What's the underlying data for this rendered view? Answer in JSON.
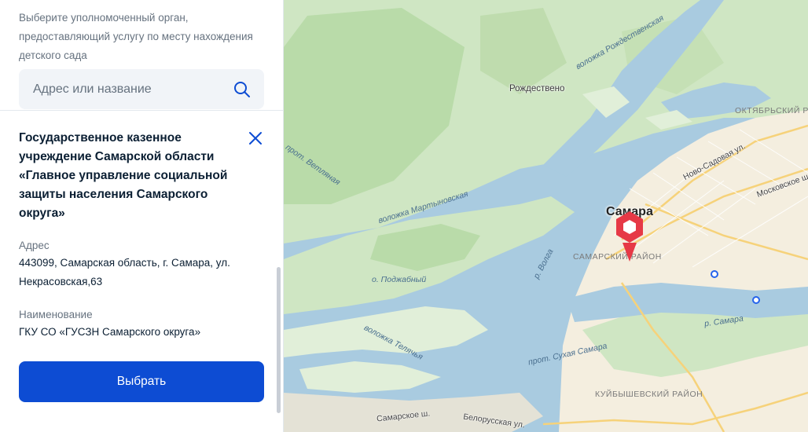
{
  "panel": {
    "prompt": "Выберите уполномоченный орган, предоставляющий услугу по месту нахождения детского сада",
    "search": {
      "placeholder": "Адрес или название",
      "icon": "search-icon"
    },
    "org": {
      "title": "Государственное казенное учреждение Самарской области «Главное управление социальной защиты населения Самарского округа»",
      "address_label": "Адрес",
      "address_value": "443099, Самарская область, г. Самара, ул. Некрасовская,63",
      "name_label": "Наименование",
      "name_value": "ГКУ СО «ГУСЗН Самарского округа»",
      "close_icon": "close-icon"
    },
    "select_button": "Выбрать",
    "colors": {
      "accent": "#0d4cd3",
      "text": "#0b1f33",
      "muted": "#66727f",
      "marker": "#e63946"
    }
  },
  "map": {
    "places": {
      "rozhdestveno": "Рождествено",
      "samara": "Самара",
      "island": "о. Поджабный"
    },
    "districts": {
      "oktyabrsky": "ОКТЯБРЬСКИЙ РАЙОН",
      "samarsky": "САМАРСКИЙ РАЙОН",
      "kuibyshevsky": "КУЙБЫШЕВСКИЙ РАЙОН"
    },
    "waterways": {
      "rozhdestvenskaya": "воложка Рождественская",
      "vetlyanaya": "прот. Ветляная",
      "martynovskaya": "воложка Мартыновская",
      "volga": "р. Волга",
      "telyachya": "воложка Телячья",
      "sukhaya_samara": "прот. Сухая Самара",
      "samara_river": "р. Самара"
    },
    "streets": {
      "novo_sadovaya": "Ново-Садовая ул.",
      "moskovskoe": "Московское ш.",
      "samarskoe": "Самарское ш.",
      "belorusskaya": "Белорусская ул."
    },
    "marker": "location-pin-icon"
  }
}
